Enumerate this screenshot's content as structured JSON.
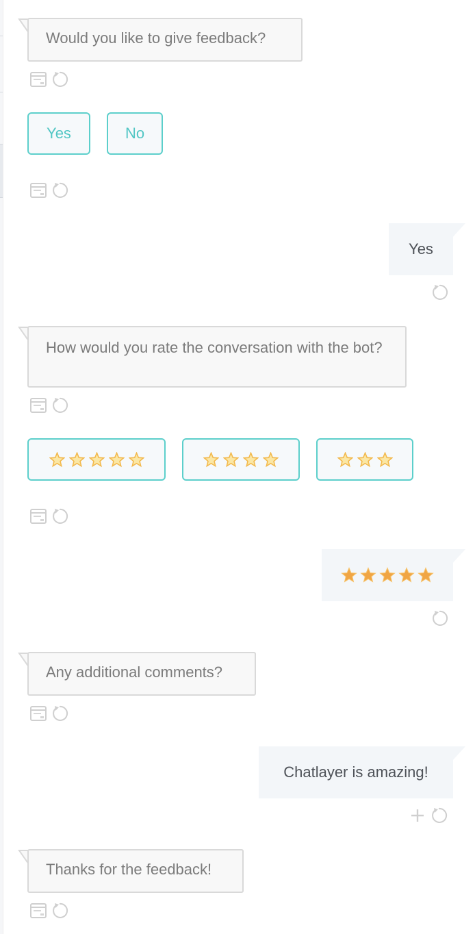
{
  "messages": {
    "m1": {
      "text": "Would you like to give feedback?"
    },
    "m2": {
      "text": "How would you rate the conversation with the bot?"
    },
    "m3": {
      "text": "Any additional comments?"
    },
    "m4": {
      "text": "Thanks for the feedback!"
    }
  },
  "choices_feedback": [
    {
      "label": "Yes"
    },
    {
      "label": "No"
    }
  ],
  "choices_rating": [
    {
      "stars": 5
    },
    {
      "stars": 4
    },
    {
      "stars": 3
    }
  ],
  "user": {
    "u1": {
      "text": "Yes"
    },
    "u2": {
      "stars": 5
    },
    "u3": {
      "text": "Chatlayer is amazing!"
    }
  },
  "icons": {
    "meta": "message-details-icon",
    "replay": "replay-icon",
    "add": "plus-icon"
  },
  "colors": {
    "accent": "#5ccfcb",
    "bot_bubble_bg": "#f8f8f8",
    "user_bubble_bg": "#f3f6f9",
    "star_outline": "#f2b84b",
    "star_filled": "#f0a544"
  }
}
